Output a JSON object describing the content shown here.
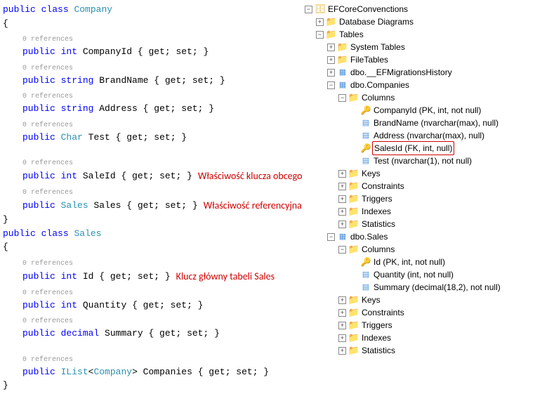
{
  "code": {
    "refs_label": "0 references",
    "class1": {
      "decl_public": "public",
      "decl_class": "class",
      "name": "Company",
      "props": [
        {
          "sig_pre": "public",
          "type_kw": "int",
          "name": "CompanyId",
          "body": " { get; set; }",
          "ann": ""
        },
        {
          "sig_pre": "public",
          "type_kw": "string",
          "name": "BrandName",
          "body": " { get; set; }",
          "ann": ""
        },
        {
          "sig_pre": "public",
          "type_kw": "string",
          "name": "Address",
          "body": " { get; set; }",
          "ann": ""
        },
        {
          "sig_pre": "public",
          "type_cls": "Char",
          "name": "Test",
          "body": " { get; set; }",
          "ann": ""
        },
        {
          "sig_pre": "public",
          "type_kw": "int",
          "name": "SaleId",
          "body": " { get; set; }",
          "ann": "Właściwość klucza obcego"
        },
        {
          "sig_pre": "public",
          "type_cls": "Sales",
          "name": "Sales",
          "body": " { get; set; }",
          "ann": "Właściwość referencyjna"
        }
      ]
    },
    "class2": {
      "decl_public": "public",
      "decl_class": "class",
      "name": "Sales",
      "props": [
        {
          "sig_pre": "public",
          "type_kw": "int",
          "name": "Id",
          "body": " { get; set; }",
          "ann": "Klucz główny tabeli Sales"
        },
        {
          "sig_pre": "public",
          "type_kw": "int",
          "name": "Quantity",
          "body": " { get; set; }",
          "ann": ""
        },
        {
          "sig_pre": "public",
          "type_kw": "decimal",
          "name": "Summary",
          "body": " { get; set; }",
          "ann": ""
        },
        {
          "sig_pre": "public",
          "type_cls": "IList",
          "generic": "Company",
          "name": "Companies",
          "body": " { get; set; }",
          "ann": ""
        }
      ]
    }
  },
  "tree": {
    "root": "EFCoreConvenctions",
    "db_diagrams": "Database Diagrams",
    "tables": "Tables",
    "system_tables": "System Tables",
    "file_tables": "FileTables",
    "ef_history": "dbo.__EFMigrationsHistory",
    "companies": "dbo.Companies",
    "columns": "Columns",
    "comp_cols": {
      "c1": "CompanyId (PK, int, not null)",
      "c2": "BrandName (nvarchar(max), null)",
      "c3": "Address (nvarchar(max), null)",
      "c4": "SalesId (FK, int, null)",
      "c5": "Test (nvarchar(1), not null)"
    },
    "keys": "Keys",
    "constraints": "Constraints",
    "triggers": "Triggers",
    "indexes": "Indexes",
    "statistics": "Statistics",
    "sales": "dbo.Sales",
    "sales_cols": {
      "c1": "Id (PK, int, not null)",
      "c2": "Quantity (int, not null)",
      "c3": "Summary (decimal(18,2), not null)"
    }
  }
}
